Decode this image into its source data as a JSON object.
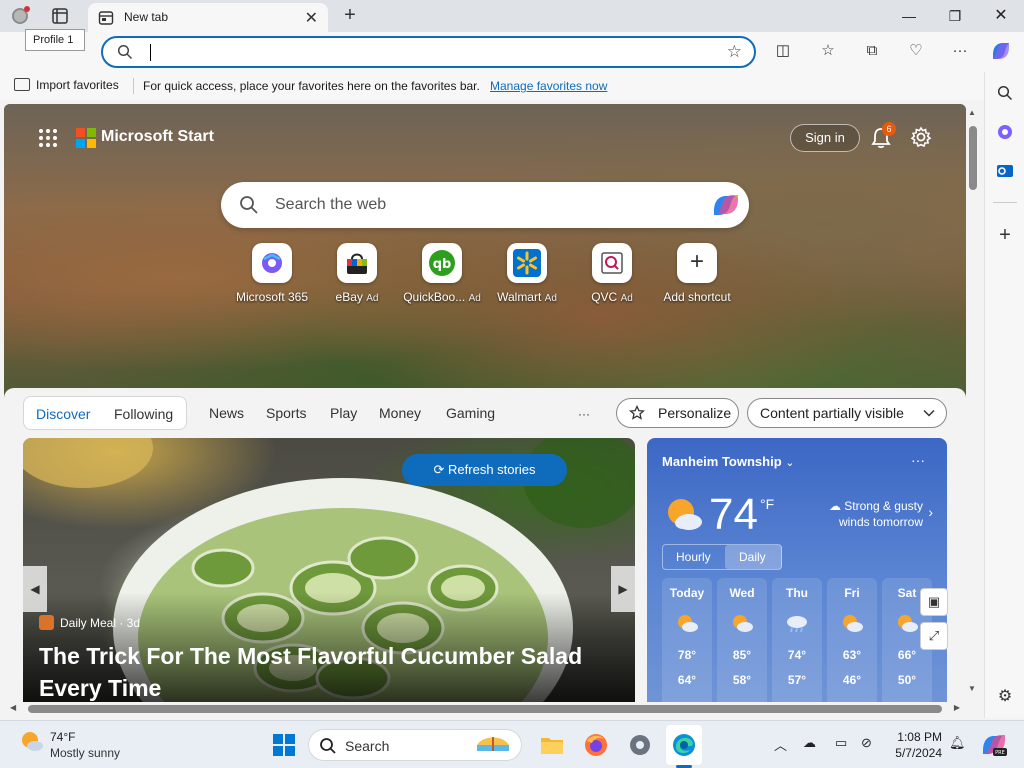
{
  "browser": {
    "profile_tooltip": "Profile 1",
    "tab_title": "New tab",
    "address_value": "",
    "favorites_bar": {
      "import_label": "Import favorites",
      "message": "For quick access, place your favorites here on the favorites bar.",
      "manage_link": "Manage favorites now"
    }
  },
  "page": {
    "brand": "Microsoft Start",
    "signin_label": "Sign in",
    "notification_count": "6",
    "search_placeholder": "Search the web",
    "shortcuts": [
      {
        "label": "Microsoft 365",
        "ad": ""
      },
      {
        "label": "eBay",
        "ad": "Ad"
      },
      {
        "label": "QuickBoo...",
        "ad": "Ad"
      },
      {
        "label": "Walmart",
        "ad": "Ad"
      },
      {
        "label": "QVC",
        "ad": "Ad"
      },
      {
        "label": "Add shortcut",
        "ad": ""
      }
    ],
    "feed_tabs": [
      "Discover",
      "Following"
    ],
    "feed_nav": [
      "News",
      "Sports",
      "Play",
      "Money",
      "Gaming"
    ],
    "more_label": "···",
    "personalize_label": "Personalize",
    "content_filter_label": "Content partially visible",
    "story": {
      "refresh_label": "Refresh stories",
      "source": "Daily Meal · 3d",
      "headline": "The Trick For The Most Flavorful Cucumber Salad Every Time"
    },
    "weather": {
      "location": "Manheim Township",
      "temp": "74",
      "unit": "°F",
      "alert": "Strong & gusty winds tomorrow",
      "toggle": [
        "Hourly",
        "Daily"
      ],
      "forecast": [
        {
          "day": "Today",
          "hi": "78°",
          "lo": "64°",
          "icon": "partly-cloudy"
        },
        {
          "day": "Wed",
          "hi": "85°",
          "lo": "58°",
          "icon": "partly-cloudy"
        },
        {
          "day": "Thu",
          "hi": "74°",
          "lo": "57°",
          "icon": "rain"
        },
        {
          "day": "Fri",
          "hi": "63°",
          "lo": "46°",
          "icon": "partly-cloudy"
        },
        {
          "day": "Sat",
          "hi": "66°",
          "lo": "50°",
          "icon": "partly-cloudy"
        }
      ]
    }
  },
  "taskbar": {
    "weather_temp": "74°F",
    "weather_condition": "Mostly sunny",
    "search_label": "Search",
    "time": "1:08 PM",
    "date": "5/7/2024"
  },
  "colors": {
    "accent": "#0f6cbd",
    "badge": "#e8590c",
    "weather_card": "#4a76cc"
  }
}
